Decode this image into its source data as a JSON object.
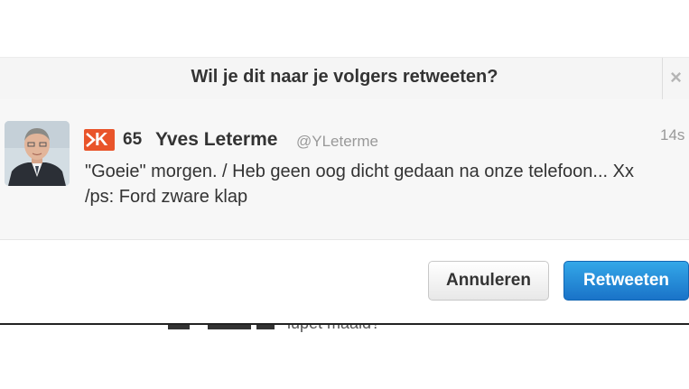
{
  "dialog": {
    "title": "Wil je dit naar je volgers retweeten?",
    "close_glyph": "×"
  },
  "tweet": {
    "klout_score": "65",
    "klout_icon": "klout-k-icon",
    "klout_letter": "K",
    "author_name": "Yves Leterme",
    "handle": "@YLeterme",
    "timestamp": "14s",
    "text": "\"Goeie\" morgen. / Heb geen oog dicht gedaan na onze telefoon... Xx\n/ps: Ford zware klap"
  },
  "buttons": {
    "cancel_label": "Annuleren",
    "retweet_label": "Retweeten"
  },
  "background_page": {
    "partial_text": "iupet maald?"
  },
  "colors": {
    "accent": "#1a73c8",
    "klout": "#e9542a"
  }
}
